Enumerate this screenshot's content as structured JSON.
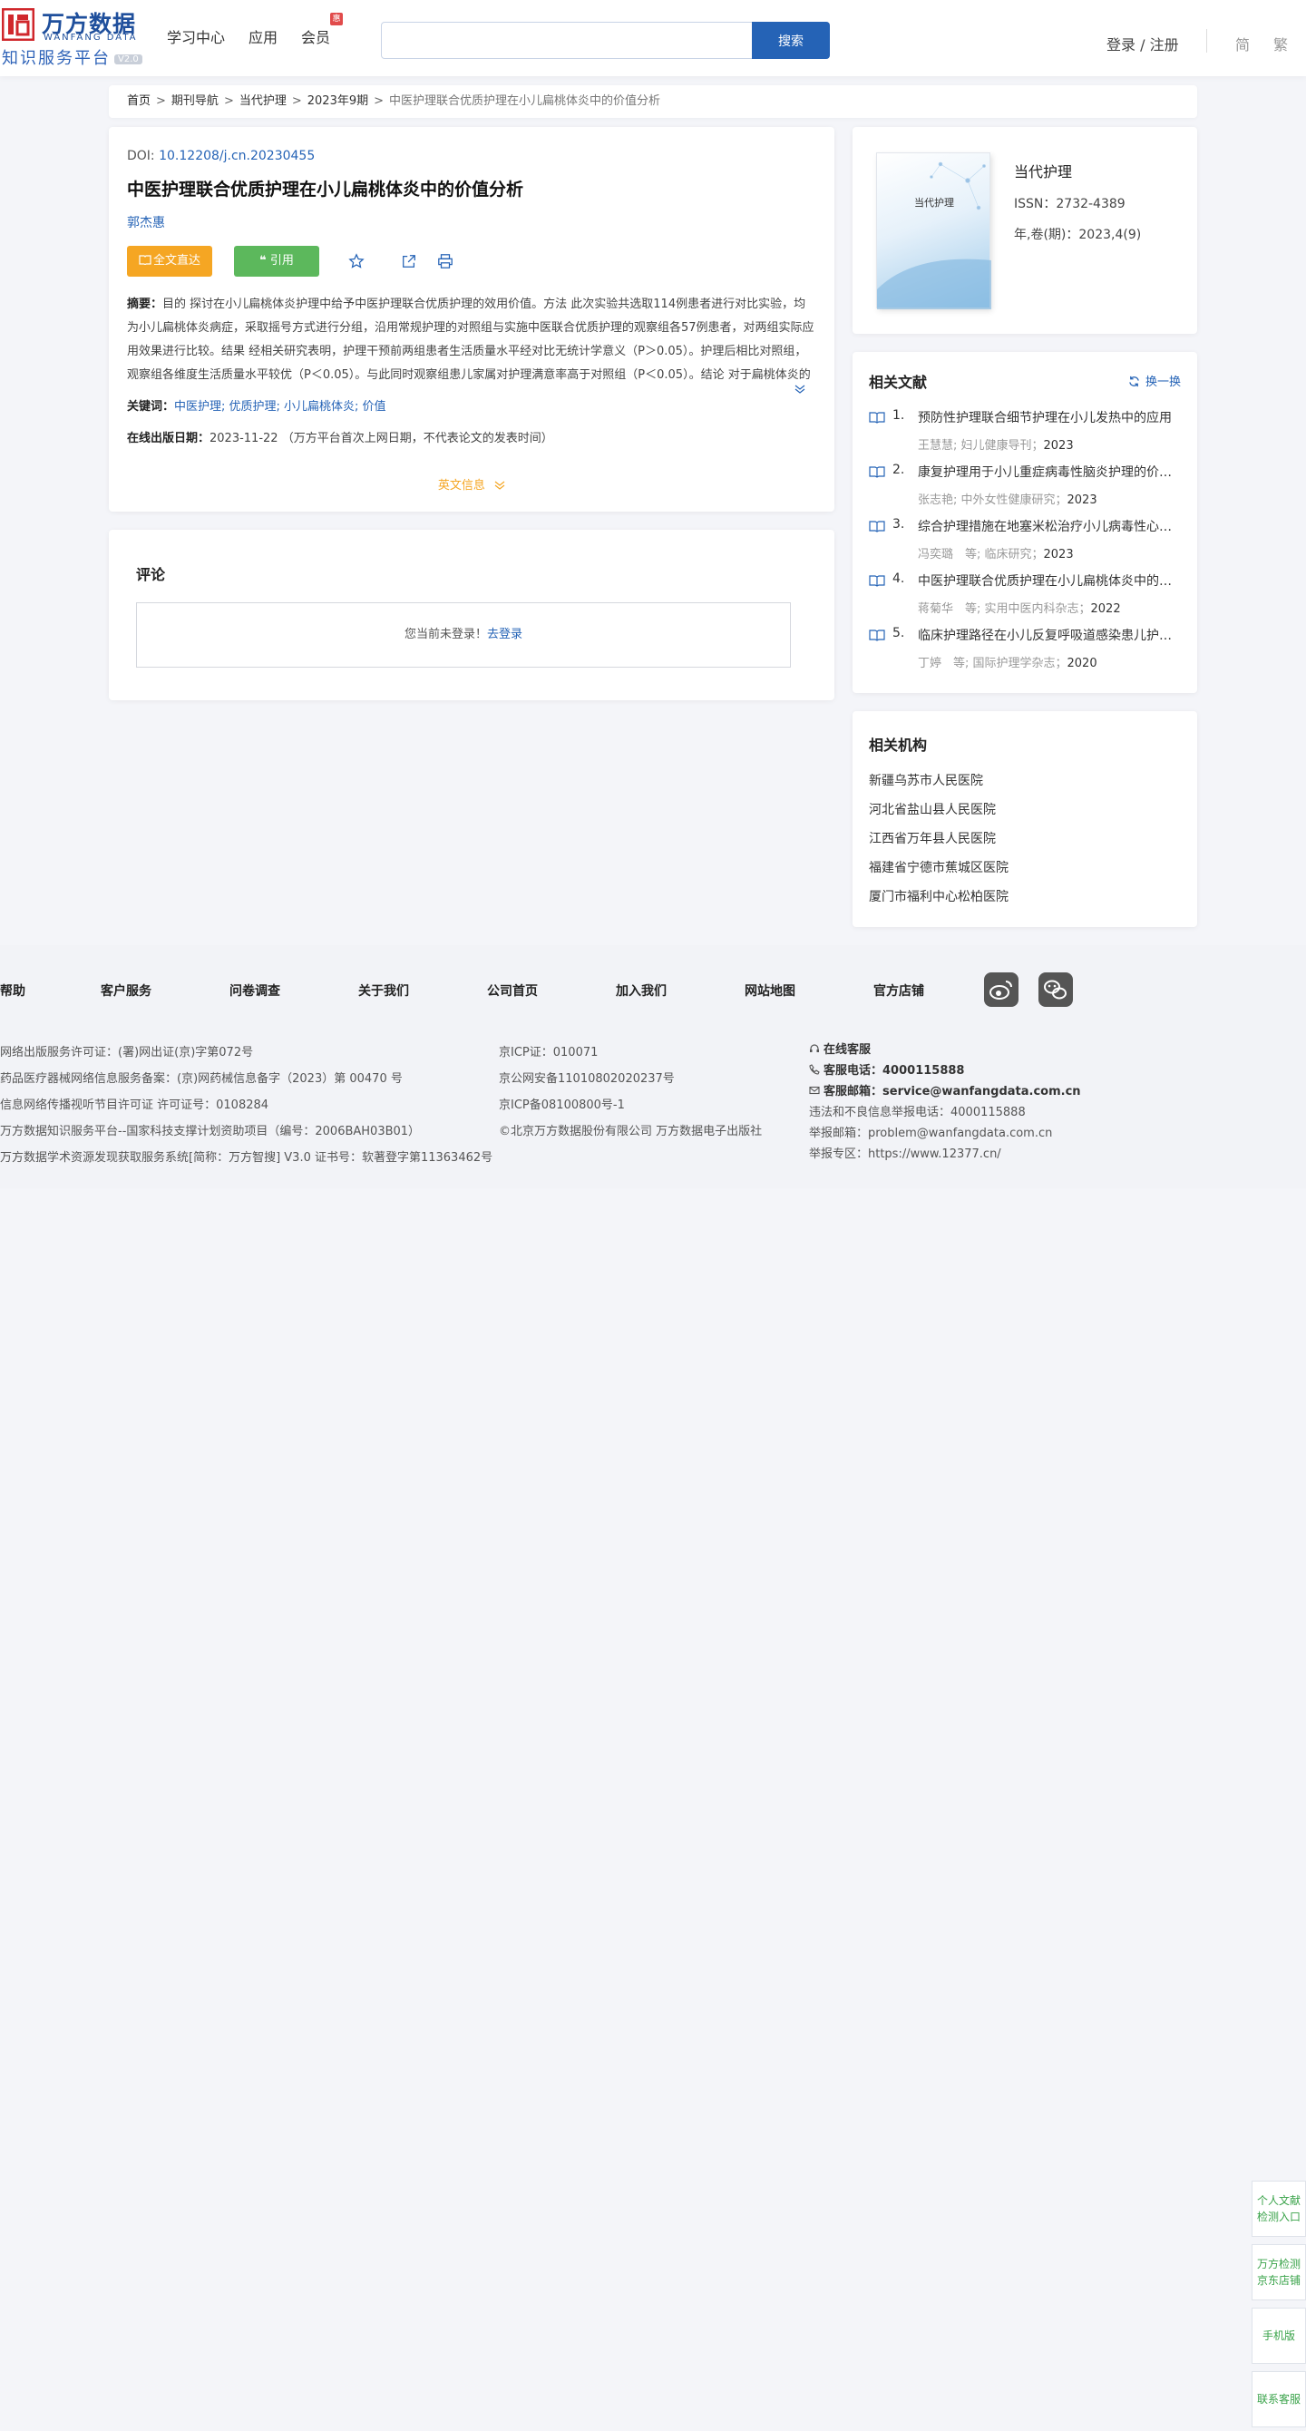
{
  "header": {
    "logo_cn": "万方数据",
    "logo_en": "WANFANG DATA",
    "logo_sub": "知识服务平台",
    "logo_ver": "V2.0",
    "nav": [
      "学习中心",
      "应用",
      "会员"
    ],
    "vip_badge": "惠",
    "search_placeholder": "",
    "search_button": "搜索",
    "login": "登录 / 注册",
    "lang_simplified": "简",
    "lang_traditional": "繁"
  },
  "breadcrumb": {
    "home": "首页",
    "items": [
      "期刊导航",
      "当代护理",
      "2023年9期"
    ],
    "current": "中医护理联合优质护理在小儿扁桃体炎中的价值分析",
    "sep": ">"
  },
  "article": {
    "doi_label": "DOI:",
    "doi": "10.12208/j.cn.20230455",
    "title": "中医护理联合优质护理在小儿扁桃体炎中的价值分析",
    "author": "郭杰惠",
    "btn_full": "全文直达",
    "btn_cite": "引用",
    "abstract_label": "摘要：",
    "abstract": "目的 探讨在小儿扁桃体炎护理中给予中医护理联合优质护理的效用价值。方法 此次实验共选取114例患者进行对比实验，均为小儿扁桃体炎病症，采取摇号方式进行分组，沿用常规护理的对照组与实施中医联合优质护理的观察组各57例患者，对两组实际应用效果进行比较。结果 经相关研究表明，护理干预前两组患者生活质量水平经对比无统计学意义（P＞0.05）。护理后相比对照组，观察组各维度生活质量水平较优（P＜0.05）。与此同时观察组患儿家属对护理满意率高于对照组（P＜0.05）。结论 对于扁桃体炎的患儿而言，在其临床诊治期间予以中医联合优质护理可有效提升其生活质量水...",
    "keywords_label": "关键词：",
    "keywords": "中医护理; 优质护理; 小儿扁桃体炎; 价值",
    "pubdate_label": "在线出版日期：",
    "pubdate": "2023-11-22",
    "pubdate_note": "（万方平台首次上网日期，不代表论文的发表时间）",
    "en_info": "英文信息"
  },
  "comments": {
    "title": "评论",
    "not_logged": "您当前未登录！",
    "go_login": "去登录"
  },
  "journal": {
    "cover_title": "当代护理",
    "name": "当代护理",
    "issn": "ISSN：2732-4389",
    "issue": "年,卷(期)：2023,4(9)"
  },
  "related": {
    "title": "相关文献",
    "refresh": "换一换",
    "items": [
      {
        "num": "1.",
        "title": "预防性护理联合细节护理在小儿发热中的应用",
        "meta": "王慧慧; 妇儿健康导刊；",
        "year": "2023"
      },
      {
        "num": "2.",
        "title": "康复护理用于小儿重症病毒性脑炎护理的价值分析",
        "meta": "张志艳; 中外女性健康研究；",
        "year": "2023"
      },
      {
        "num": "3.",
        "title": "综合护理措施在地塞米松治疗小儿病毒性心肌炎中的应用",
        "meta": "冯奕璐　等; 临床研究；",
        "year": "2023"
      },
      {
        "num": "4.",
        "title": "中医护理联合优质护理在小儿扁桃体炎中的价值分析",
        "meta": "蒋菊华　等; 实用中医内科杂志；",
        "year": "2022"
      },
      {
        "num": "5.",
        "title": "临床护理路径在小儿反复呼吸道感染患儿护理中的应用",
        "meta": "丁婷　等; 国际护理学杂志；",
        "year": "2020"
      }
    ]
  },
  "orgs": {
    "title": "相关机构",
    "items": [
      "新疆乌苏市人民医院",
      "河北省盐山县人民医院",
      "江西省万年县人民医院",
      "福建省宁德市蕉城区医院",
      "厦门市福利中心松柏医院"
    ]
  },
  "footer": {
    "links": [
      "帮助",
      "客户服务",
      "问卷调查",
      "关于我们",
      "公司首页",
      "加入我们",
      "网站地图",
      "官方店铺"
    ],
    "col1": [
      "网络出版服务许可证：(署)网出证(京)字第072号",
      "药品医疗器械网络信息服务备案：(京)网药械信息备字（2023）第 00470 号",
      "信息网络传播视听节目许可证 许可证号：0108284",
      "万方数据知识服务平台--国家科技支撑计划资助项目（编号：2006BAH03B01）",
      "万方数据学术资源发现获取服务系统[简称：万方智搜] V3.0 证书号：软著登字第11363462号"
    ],
    "col2": [
      "京ICP证：010071",
      "京公网安备11010802020237号",
      "京ICP备08100800号-1",
      "©北京万方数据股份有限公司 万方数据电子出版社"
    ],
    "online_service": "在线客服",
    "phone_label": "客服电话：",
    "phone": "4000115888",
    "email_label": "客服邮箱：",
    "email": "service@wanfangdata.com.cn",
    "report_phone": "违法和不良信息举报电话：4000115888",
    "report_email": "举报邮箱：problem@wanfangdata.com.cn",
    "report_site": "举报专区：https://www.12377.cn/"
  },
  "side": [
    "个人文献检测入口",
    "万方检测京东店铺",
    "手机版",
    "联系客服"
  ],
  "colors": {
    "primary": "#2563b6",
    "accent": "#f5a623",
    "green": "#5cb85c"
  }
}
